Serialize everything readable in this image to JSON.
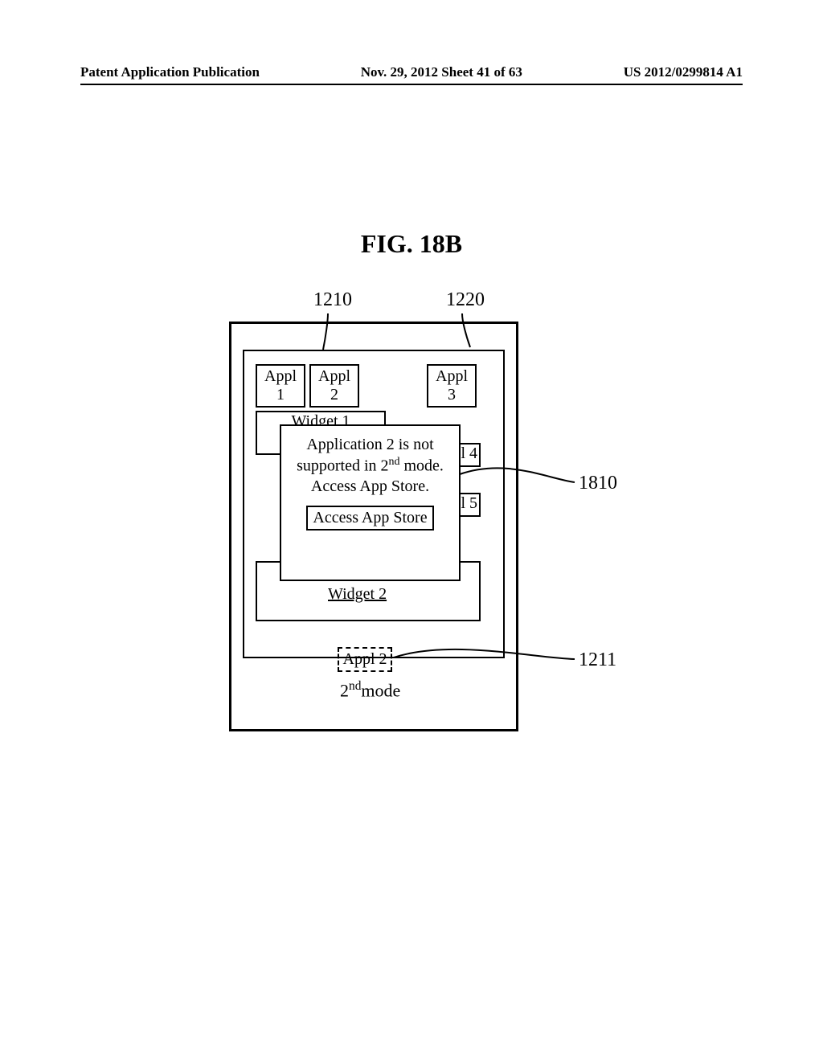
{
  "header": {
    "left": "Patent Application Publication",
    "center": "Nov. 29, 2012  Sheet 41 of 63",
    "right": "US 2012/0299814 A1"
  },
  "figure_title": "FIG. 18B",
  "refs": {
    "r1210": "1210",
    "r1220": "1220",
    "r1810": "1810",
    "r1211": "1211"
  },
  "device": {
    "apps": {
      "appl1": "Appl 1",
      "appl2": "Appl 2",
      "appl3": "Appl 3"
    },
    "widget1": "Widget 1",
    "partial4": "l 4",
    "partial5": "l 5",
    "widget2": "Widget 2",
    "popup": {
      "line1": "Application 2 is not",
      "line2_a": "supported in 2",
      "line2_b": " mode.",
      "line2_sup": "nd",
      "line3": "Access App Store.",
      "button": "Access App Store"
    },
    "bottom_app": "Appl 2",
    "mode_a": "2",
    "mode_sup": "nd",
    "mode_b": "mode"
  },
  "chart_data": {
    "type": "diagram",
    "title": "FIG. 18B",
    "description": "Patent figure showing a device screen with app icons (Appl 1, Appl 2, Appl 3), widgets (Widget 1, Widget 2), partial icons labeled 4 and 5, a popup dialog stating Application 2 is not supported in 2nd mode with an Access App Store button, a dashed Appl 2 box at bottom, and a 2nd mode label. Reference numerals: 1210 (screen area), 1220 (right/partial area), 1810 (popup), 1211 (dashed Appl 2 box).",
    "reference_numerals": {
      "1210": "screen/left app area leader",
      "1220": "right partial icon area leader",
      "1810": "popup dialog",
      "1211": "dashed Appl 2 box at bottom"
    }
  }
}
